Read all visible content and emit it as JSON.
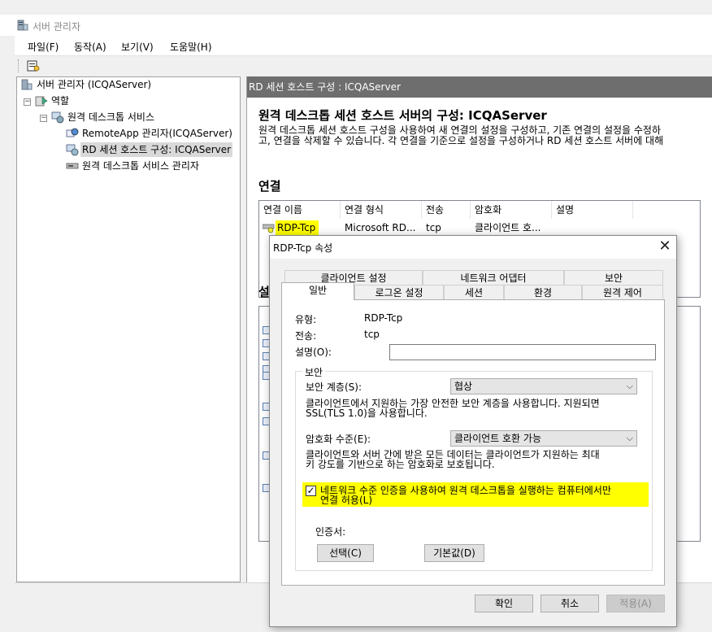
{
  "window": {
    "title": "서버 관리자",
    "menus": [
      "파일(F)",
      "동작(A)",
      "보기(V)",
      "도움말(H)"
    ]
  },
  "tree": {
    "root": "서버 관리자 (ICQAServer)",
    "roles": "역할",
    "rds": "원격 데스크톱 서비스",
    "remoteapp": "RemoteApp 관리자(ICQAServer)",
    "rdsh_config": "RD 세션 호스트 구성: ICQAServer",
    "rds_manager": "원격 데스크톱 서비스 관리자"
  },
  "right": {
    "header": "RD 세션 호스트 구성 : ICQAServer",
    "title": "원격 데스크톱 세션 호스트 서버의 구성: ICQAServer",
    "desc_line1": "원격 데스크톱 세션 호스트 구성을 사용하여 새 연결의 설정을 구성하고, 기존 연결의 설정을 수정하",
    "desc_line2": "고, 연결을 삭제할 수 있습니다. 각 연결을 기준으로 설정을 구성하거나 RD 세션 호스트 서버에 대해",
    "section": "연결",
    "settings_section": "설",
    "columns": [
      "연결 이름",
      "연결 형식",
      "전송",
      "암호화",
      "설명"
    ],
    "row": [
      "RDP-Tcp",
      "Microsoft RD...",
      "tcp",
      "클라이언트 호...",
      ""
    ]
  },
  "dialog": {
    "title": "RDP-Tcp 속성",
    "close": "✕",
    "tabs_row1": [
      "클라이언트 설정",
      "네트워크 어댑터",
      "보안"
    ],
    "tabs_row2": [
      "일반",
      "로그온 설정",
      "세션",
      "환경",
      "원격 제어"
    ],
    "type_label": "유형:",
    "type_value": "RDP-Tcp",
    "transport_label": "전송:",
    "transport_value": "tcp",
    "comment_label": "설명(O):",
    "comment_value": "",
    "security_group": "보안",
    "security_layer_label": "보안 계층(S):",
    "security_layer_value": "협상",
    "security_layer_desc_1": "클라이언트에서 지원하는 가장 안전한 보안 계층을 사용합니다. 지원되면",
    "security_layer_desc_2": "SSL(TLS 1.0)을 사용합니다.",
    "encryption_label": "암호화 수준(E):",
    "encryption_value": "클라이언트 호환 가능",
    "encryption_desc_1": "클라이언트와 서버 간에 받은 모든 데이터는 클라이언트가 지원하는 최대",
    "encryption_desc_2": "키 강도를 기반으로 하는 암호화로 보호됩니다.",
    "nla_checkbox_1": "네트워크 수준 인증을 사용하여 원격 데스크톱을 실행하는 컴퓨터에서만",
    "nla_checkbox_2": "연결 허용(L)",
    "nla_checked": true,
    "certificate_label": "인증서:",
    "select_button": "선택(C)",
    "default_button": "기본값(D)",
    "ok": "확인",
    "cancel": "취소",
    "apply": "적용(A)"
  },
  "colors": {
    "highlight": "#ffff00",
    "header_gray": "#6e6e6e",
    "selection": "#d9d9d9"
  }
}
